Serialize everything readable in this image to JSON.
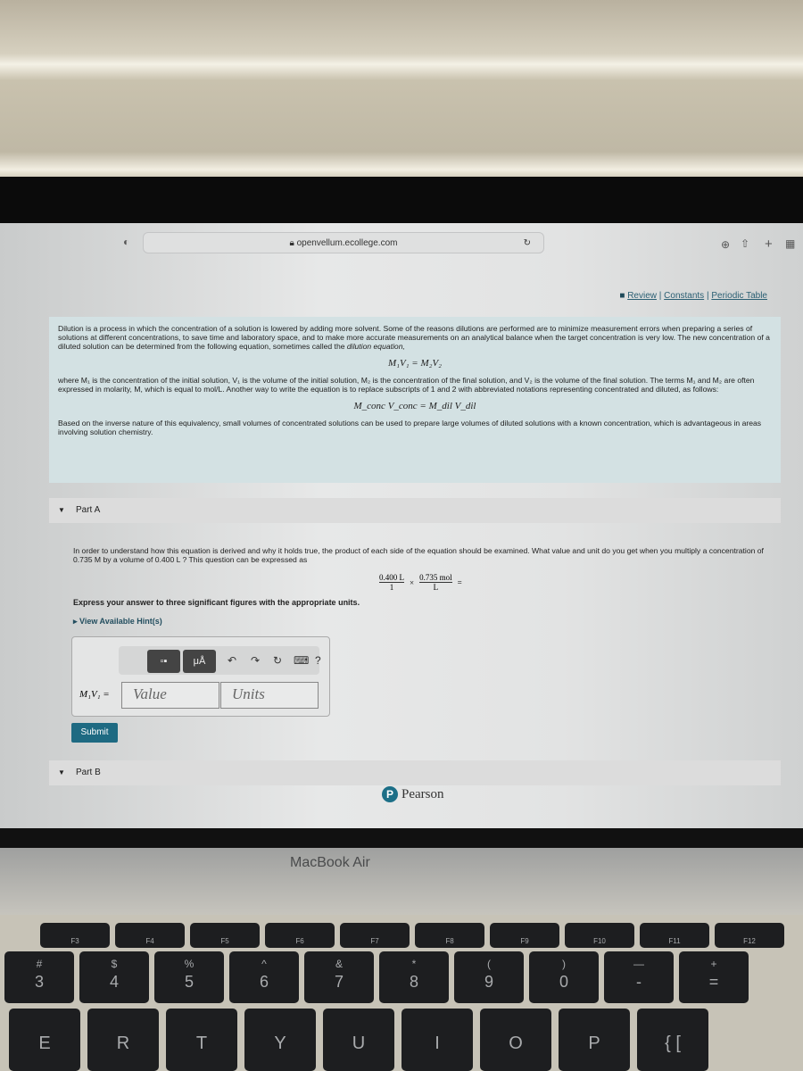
{
  "browser": {
    "url": "openvellum.ecollege.com",
    "icons": [
      "shield-icon",
      "lock-icon",
      "reload-icon",
      "download-icon",
      "share-icon",
      "new-tab-icon",
      "tabs-overview-icon"
    ]
  },
  "links": {
    "review": "Review",
    "constants": "Constants",
    "periodic": "Periodic Table",
    "sep": "|"
  },
  "intro": {
    "p1_a": "Dilution is a process in which the concentration of a solution is lowered by adding more solvent. Some of the reasons dilutions are performed are to minimize measurement errors when preparing a series of solutions at different concentrations, to save time and laboratory space, and to make more accurate measurements on an analytical balance when the target concentration is very low. The new concentration of a diluted solution can be determined from the following equation, sometimes called the ",
    "p1_em": "dilution equation,",
    "eq1": "M₁V₁ = M₂V₂",
    "p2": "where M₁ is the concentration of the initial solution, V₁ is the volume of the initial solution, M₂ is the concentration of the final solution, and V₂ is the volume of the final solution. The terms M₁ and M₂ are often expressed in molarity, M, which is equal to mol/L. Another way to write the equation is to replace subscripts of 1 and 2 with abbreviated notations representing concentrated and diluted, as follows:",
    "eq2": "M_conc V_conc = M_dil V_dil",
    "p3": "Based on the inverse nature of this equivalency, small volumes of concentrated solutions can be used to prepare large volumes of diluted solutions with a known concentration, which is advantageous in areas involving solution chemistry."
  },
  "partA": {
    "title": "Part A",
    "question": "In order to understand how this equation is derived and why it holds true, the product of each side of the equation should be examined. What value and unit do you get when you multiply a concentration of 0.735  M by a volume of 0.400  L ? This question can be expressed as",
    "frac1_num": "0.400 L",
    "frac1_den": "1",
    "times": "×",
    "frac2_num": "0.735 mol",
    "frac2_den": "L",
    "equals": "=",
    "instruction": "Express your answer to three significant figures with the appropriate units.",
    "hint": "▸ View Available Hint(s)",
    "toolbar": {
      "templates": "▫▪",
      "units": "μÅ",
      "undo": "↶",
      "redo": "↷",
      "reset": "↻",
      "keyboard": "⌨",
      "help": "?"
    },
    "answer_label": "M₁V₁ =",
    "value_placeholder": "Value",
    "units_placeholder": "Units",
    "submit": "Submit"
  },
  "partB": {
    "title": "Part B"
  },
  "footer": {
    "brand": "Pearson",
    "logo": "P"
  },
  "laptop": {
    "model": "MacBook Air"
  },
  "keyboard": {
    "fkeys": [
      "F3",
      "F4",
      "F5",
      "F6",
      "F7",
      "F8",
      "F9",
      "F10",
      "F11",
      "F12"
    ],
    "numkeys": [
      [
        "#",
        "3"
      ],
      [
        "$",
        "4"
      ],
      [
        "%",
        "5"
      ],
      [
        "^",
        "6"
      ],
      [
        "&",
        "7"
      ],
      [
        "*",
        "8"
      ],
      [
        "(",
        "9"
      ],
      [
        ")",
        "0"
      ],
      [
        "—",
        "-"
      ],
      [
        "+",
        "="
      ]
    ],
    "letters": [
      "E",
      "R",
      "T",
      "Y",
      "U",
      "I",
      "O",
      "P",
      "{ ["
    ]
  }
}
